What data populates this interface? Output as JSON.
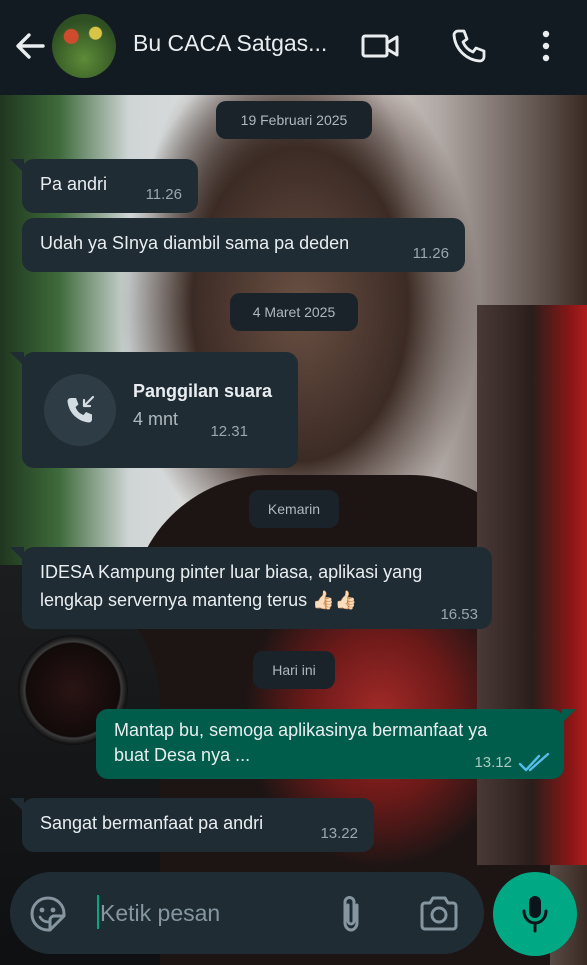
{
  "header": {
    "title": "Bu CACA Satgas...",
    "icons": [
      "back-arrow-icon",
      "contact-avatar",
      "video-call-icon",
      "voice-call-icon",
      "more-options-icon"
    ]
  },
  "messages": [
    {
      "type": "date",
      "text": "19 Februari 2025"
    },
    {
      "type": "incoming",
      "text": "Pa andri",
      "time": "11.26"
    },
    {
      "type": "incoming",
      "text": "Udah ya SInya diambil sama pa deden",
      "time": "11.26"
    },
    {
      "type": "date",
      "text": "4 Maret 2025"
    },
    {
      "type": "call",
      "title": "Panggilan suara",
      "duration": "4 mnt",
      "time": "12.31"
    },
    {
      "type": "date",
      "text": "Kemarin"
    },
    {
      "type": "incoming",
      "lines": [
        "IDESA Kampung pinter luar biasa, aplikasi yang",
        "lengkap servernya manteng terus 👍🏻👍🏻"
      ],
      "time": "16.53"
    },
    {
      "type": "date",
      "text": "Hari ini"
    },
    {
      "type": "outgoing",
      "lines": [
        "Mantap bu, semoga aplikasinya bermanfaat ya",
        "buat Desa nya ..."
      ],
      "time": "13.12",
      "status": "read"
    },
    {
      "type": "incoming",
      "text": "Sangat bermanfaat pa andri",
      "time": "13.22"
    }
  ],
  "composer": {
    "placeholder": "Ketik pesan",
    "icons": [
      "emoji-sticker-icon",
      "attach-icon",
      "camera-icon",
      "mic-icon"
    ]
  },
  "colors": {
    "header_bg": "#121b22",
    "incoming_bubble": "#1f2c34",
    "outgoing_bubble": "#005c4b",
    "accent": "#00a884",
    "read_ticks": "#53bdeb"
  }
}
